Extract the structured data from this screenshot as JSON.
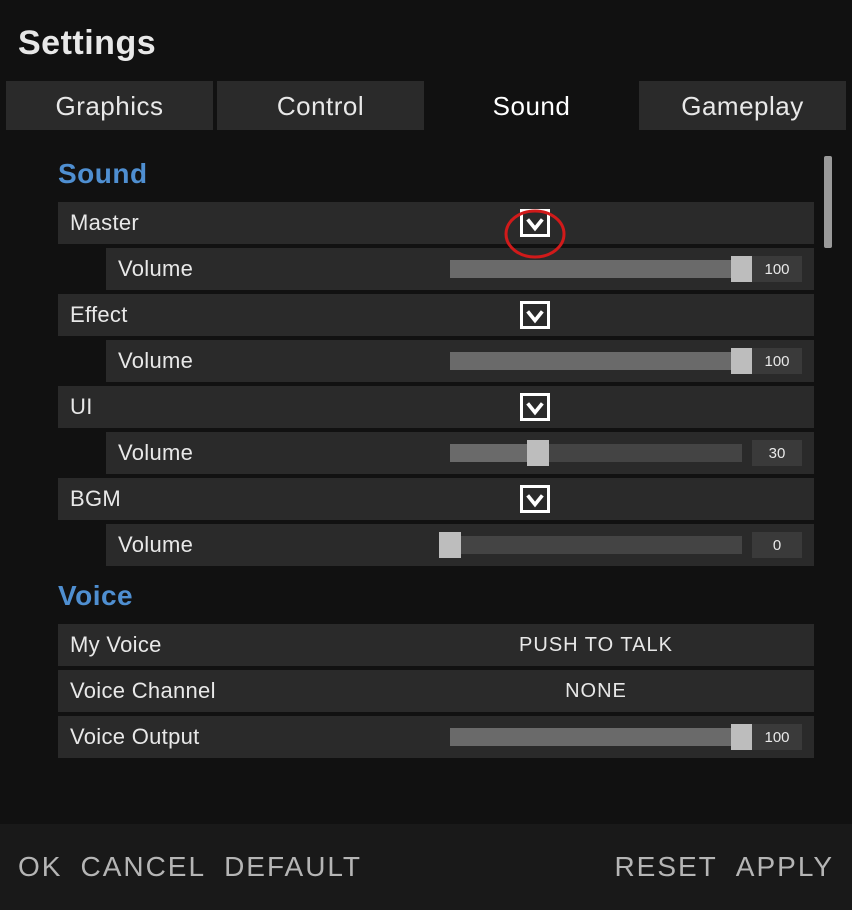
{
  "title": "Settings",
  "tabs": [
    {
      "label": "Graphics",
      "active": false
    },
    {
      "label": "Control",
      "active": false
    },
    {
      "label": "Sound",
      "active": true
    },
    {
      "label": "Gameplay",
      "active": false
    }
  ],
  "sections": {
    "sound": {
      "title": "Sound",
      "groups": [
        {
          "label": "Master",
          "checked": true,
          "volume": 100
        },
        {
          "label": "Effect",
          "checked": true,
          "volume": 100
        },
        {
          "label": "UI",
          "checked": true,
          "volume": 30
        },
        {
          "label": "BGM",
          "checked": true,
          "volume": 0
        }
      ],
      "volume_label": "Volume"
    },
    "voice": {
      "title": "Voice",
      "my_voice": {
        "label": "My Voice",
        "value": "PUSH TO TALK"
      },
      "voice_channel": {
        "label": "Voice Channel",
        "value": "NONE"
      },
      "voice_output": {
        "label": "Voice Output",
        "volume": 100
      }
    }
  },
  "footer": {
    "left": [
      "OK",
      "CANCEL",
      "DEFAULT"
    ],
    "right": [
      "RESET",
      "APPLY"
    ]
  },
  "colors": {
    "accent": "#4f8fd1",
    "annotation": "#d11a1a"
  }
}
